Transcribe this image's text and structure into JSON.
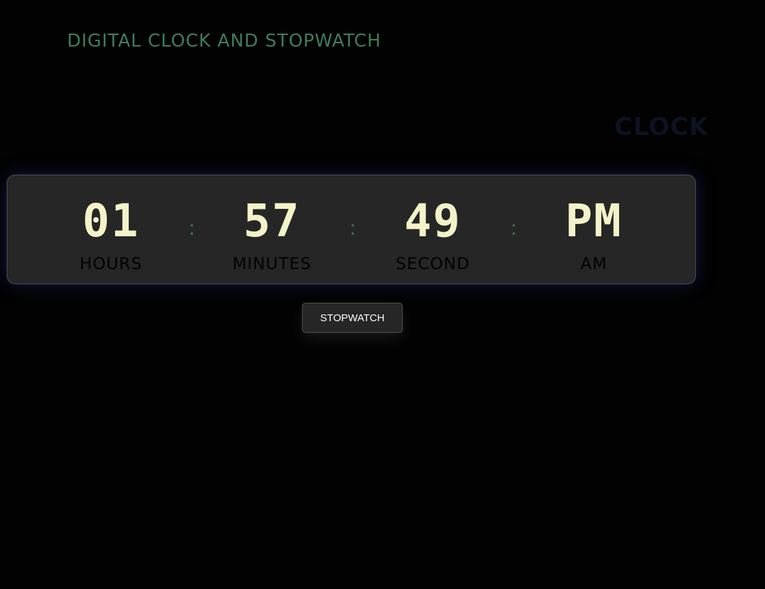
{
  "app": {
    "title": "DIGITAL CLOCK AND STOPWATCH",
    "mode_label": "CLOCK"
  },
  "clock": {
    "hours": {
      "value": "01",
      "label": "HOURS"
    },
    "minutes": {
      "value": "57",
      "label": "MINUTES"
    },
    "seconds": {
      "value": "49",
      "label": "SECOND"
    },
    "period": {
      "value": "PM",
      "label": "AM"
    },
    "separator": ":"
  },
  "actions": {
    "stopwatch_label": "STOPWATCH"
  },
  "colors": {
    "background": "#020202",
    "panel": "#262626",
    "title_green": "#3f7e5b",
    "digit_cream": "#f4f2c9",
    "glow_blue": "#303a91"
  }
}
